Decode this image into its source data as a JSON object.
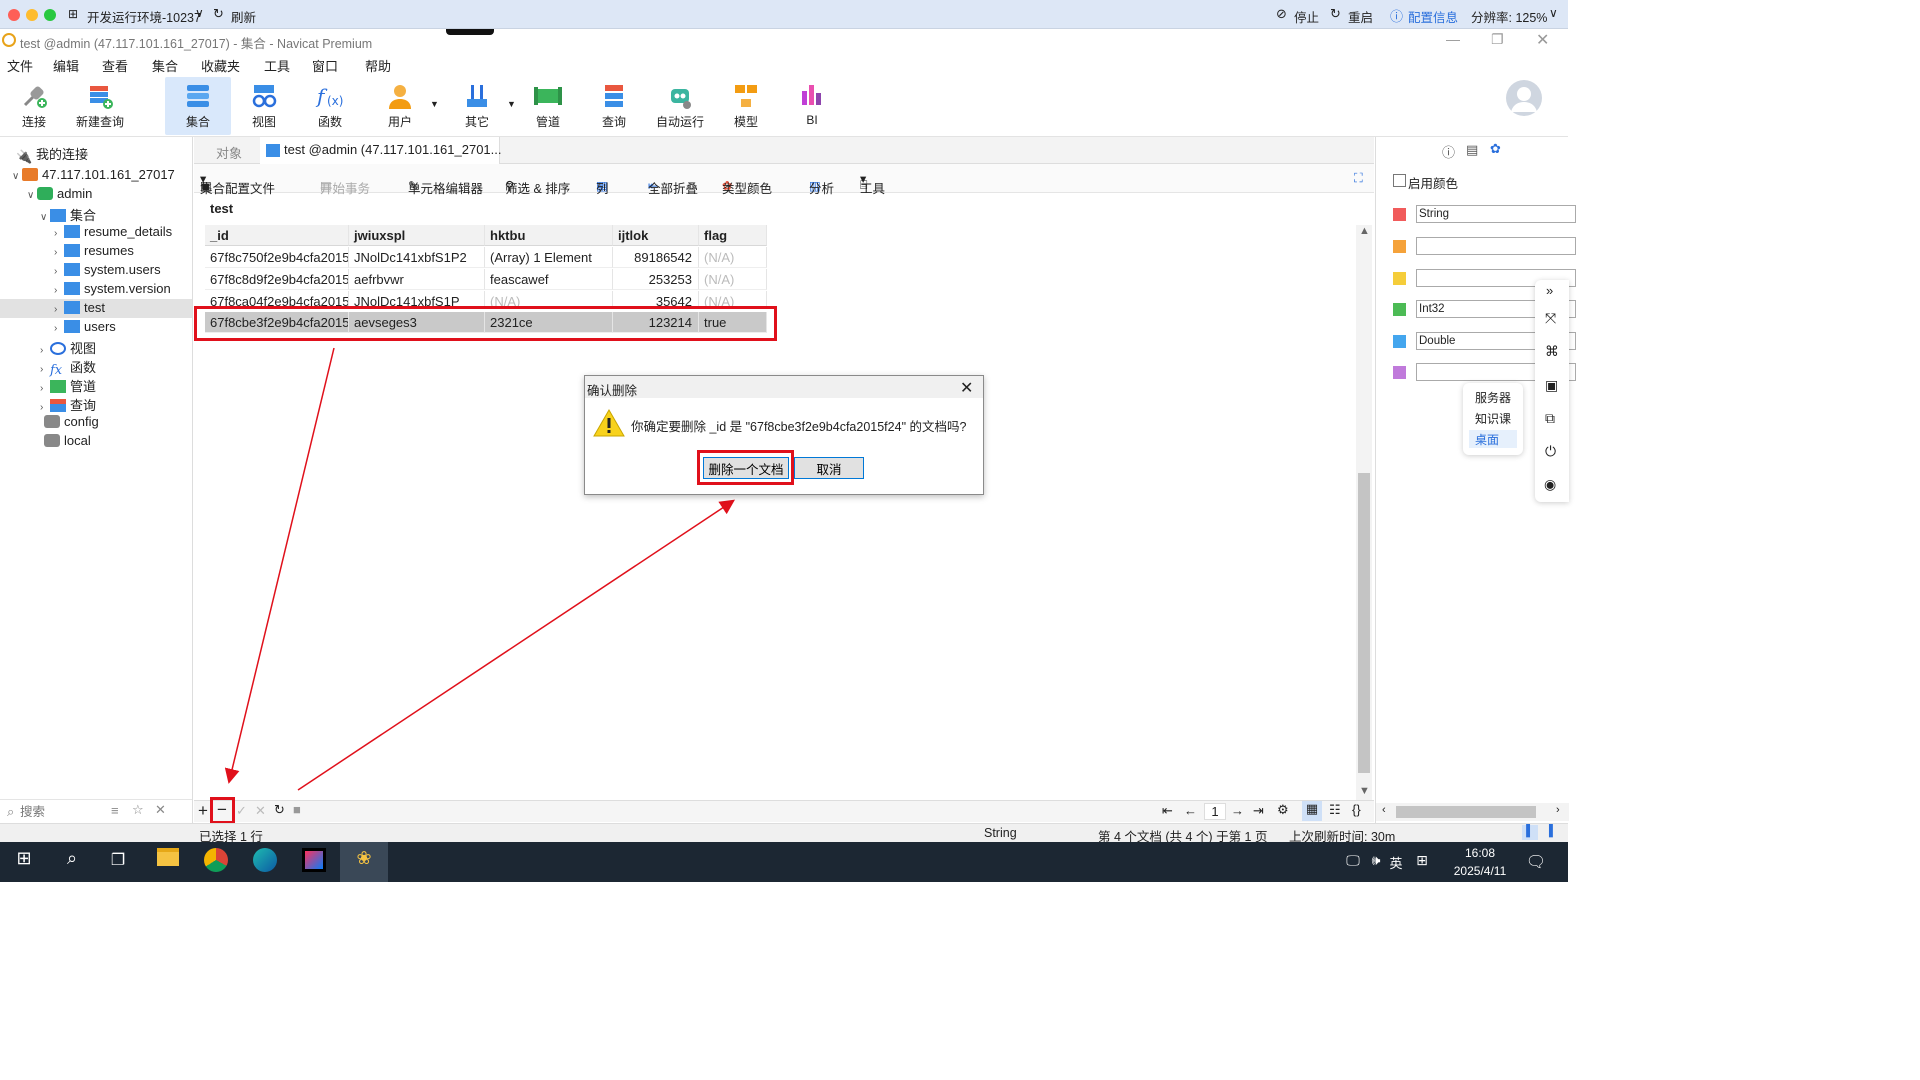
{
  "topbar": {
    "env_label": "开发运行环境-10237",
    "refresh": "刷新",
    "stop": "停止",
    "restart": "重启",
    "config": "配置信息",
    "resolution": "分辨率: 125%"
  },
  "window": {
    "title": "test @admin (47.117.101.161_27017) - 集合 - Navicat Premium"
  },
  "menu": [
    "文件",
    "编辑",
    "查看",
    "集合",
    "收藏夹",
    "工具",
    "窗口",
    "帮助"
  ],
  "toolbar": [
    "连接",
    "新建查询",
    "集合",
    "视图",
    "函数",
    "用户",
    "其它",
    "管道",
    "查询",
    "自动运行",
    "模型",
    "BI"
  ],
  "sidebar": {
    "root": "我的连接",
    "connection": "47.117.101.161_27017",
    "db": "admin",
    "group": "集合",
    "collections": [
      "resume_details",
      "resumes",
      "system.users",
      "system.version",
      "test",
      "users"
    ],
    "others": [
      "视图",
      "函数",
      "管道",
      "查询"
    ],
    "dbs": [
      "config",
      "local"
    ],
    "search_placeholder": "搜索"
  },
  "tabs": {
    "objects": "对象",
    "active": "test @admin (47.117.101.161_2701..."
  },
  "subtoolbar": {
    "profile": "集合配置文件",
    "begin_tx": "开始事务",
    "cell_editor": "单元格编辑器",
    "filter_sort": "筛选 & 排序",
    "columns": "列",
    "fold": "全部折叠",
    "type_color": "类型颜色",
    "analyze": "分析",
    "tools": "工具"
  },
  "collection_name": "test",
  "table": {
    "headers": [
      "_id",
      "jwiuxspl",
      "hktbu",
      "ijtlok",
      "flag"
    ],
    "rows": [
      [
        "67f8c750f2e9b4cfa2015",
        "JNolDc141xbfS1P2",
        "(Array) 1 Element",
        "89186542",
        "(N/A)"
      ],
      [
        "67f8c8d9f2e9b4cfa2015",
        "aefrbvwr",
        "feascawef",
        "253253",
        "(N/A)"
      ],
      [
        "67f8ca04f2e9b4cfa2015",
        "JNolDc141xbfS1P",
        "(N/A)",
        "35642",
        "(N/A)"
      ],
      [
        "67f8cbe3f2e9b4cfa2015",
        "aevseges3",
        "2321ce",
        "123214",
        "true"
      ]
    ]
  },
  "dialog": {
    "title": "确认删除",
    "message": "你确定要删除 _id 是 \"67f8cbe3f2e9b4cfa2015f24\" 的文档吗?",
    "confirm": "删除一个文档",
    "cancel": "取消"
  },
  "right_panel": {
    "enable_color": "启用颜色",
    "types": [
      "String",
      "",
      "",
      "Int32",
      "Double",
      ""
    ],
    "colors": [
      "#f15b5b",
      "#f5a23a",
      "#f5cd3a",
      "#4cbb55",
      "#44a6ee",
      "#c07adb"
    ],
    "popup": [
      "服务器",
      "知识课",
      "桌面"
    ]
  },
  "pager": {
    "page": "1"
  },
  "status": {
    "selected": "已选择 1 行",
    "type": "String",
    "doc_info": "第 4 个文档 (共 4 个) 于第 1 页",
    "last_refresh": "上次刷新时间: 30m"
  },
  "taskbar": {
    "ime": "英",
    "time": "16:08",
    "date": "2025/4/11"
  }
}
